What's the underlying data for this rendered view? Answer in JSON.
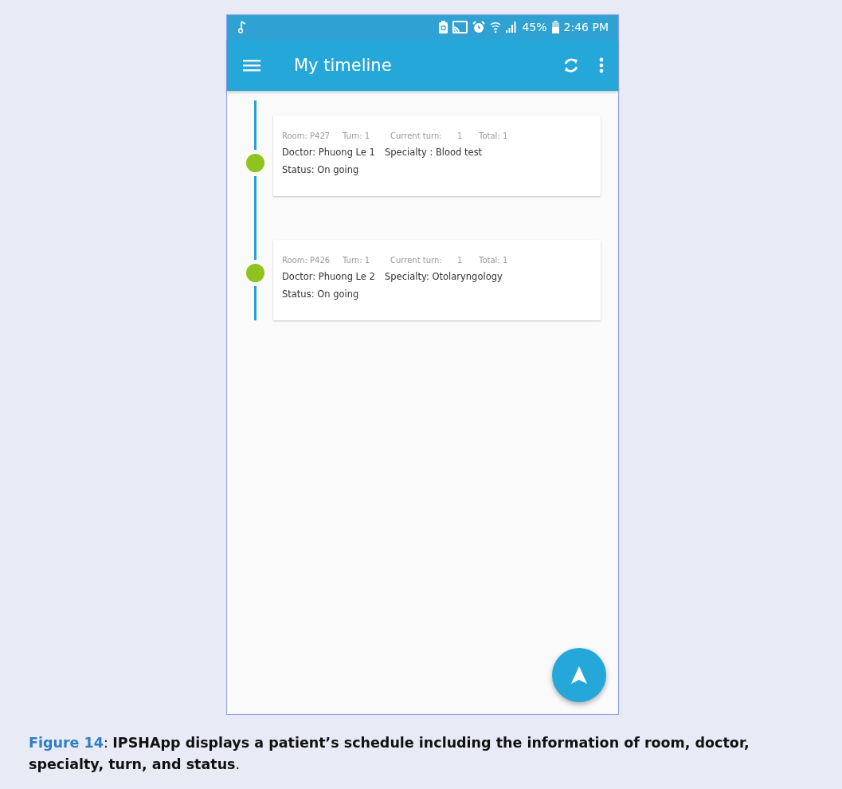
{
  "status_bar": {
    "battery": "45%",
    "time": "2:46 PM"
  },
  "app_bar": {
    "title": "My timeline"
  },
  "timeline": [
    {
      "room": "Room: P427",
      "turn": "Turn: 1",
      "current_turn_label": "Current turn:",
      "current_turn": "1",
      "total": "Total: 1",
      "doctor": "Doctor: Phuong Le 1",
      "specialty": "Specialty : Blood test",
      "status": "Status: On going"
    },
    {
      "room": "Room: P426",
      "turn": "Turn: 1",
      "current_turn_label": "Current turn:",
      "current_turn": "1",
      "total": "Total: 1",
      "doctor": "Doctor: Phuong Le 2",
      "specialty": "Specialty: Otolaryngology",
      "status": "Status: On going"
    }
  ],
  "caption": {
    "label": "Figure 14",
    "text": ": **IPSHApp displays a patient’s schedule including the information of room, doctor, specialty, turn, and status**."
  }
}
